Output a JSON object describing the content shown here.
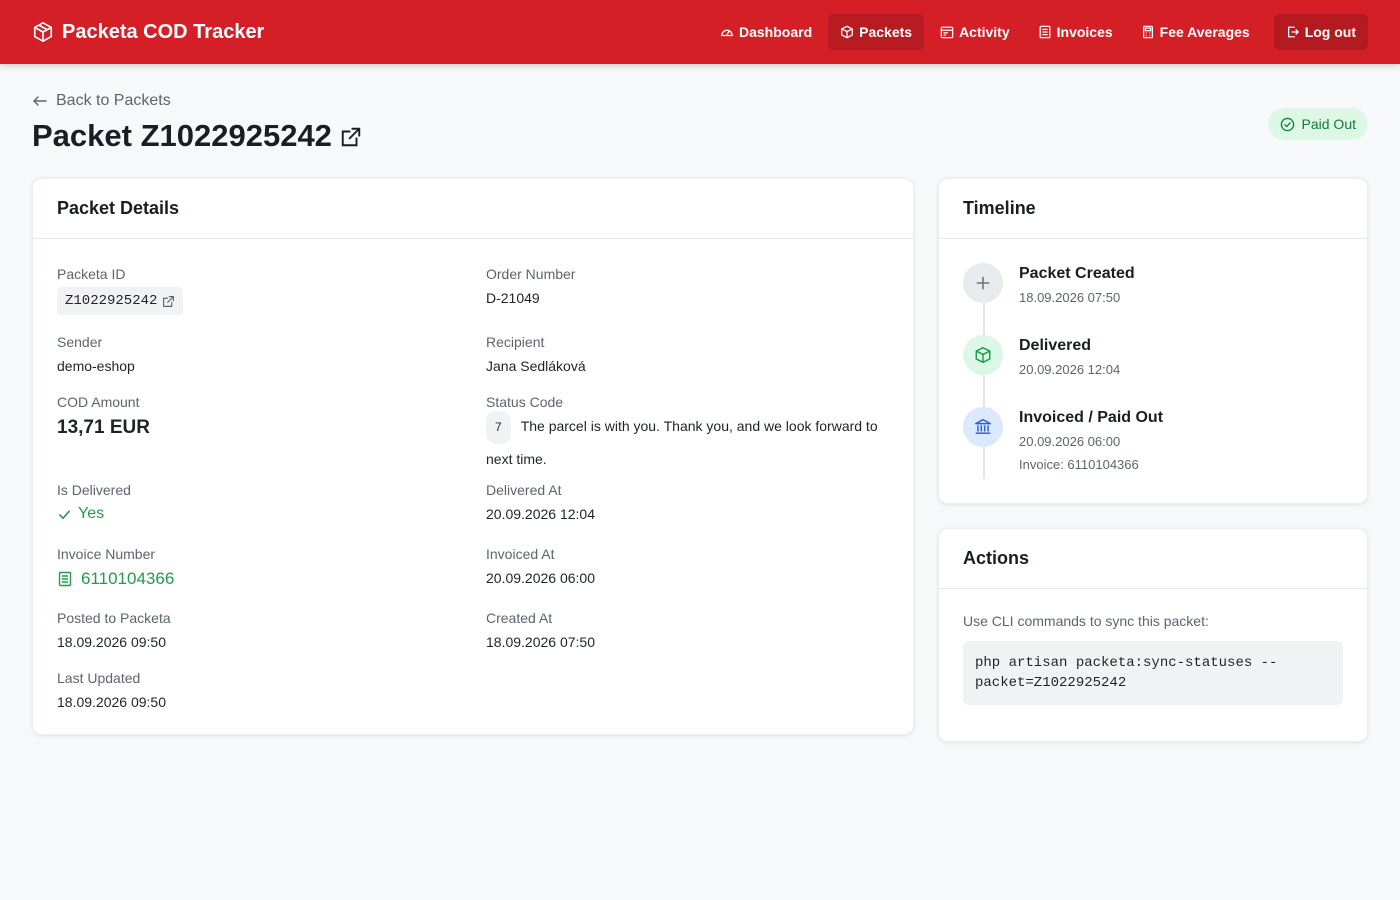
{
  "nav": {
    "brand": "Packeta COD Tracker",
    "links": [
      "Dashboard",
      "Packets",
      "Activity",
      "Invoices",
      "Fee Averages"
    ],
    "logout": "Log out"
  },
  "page": {
    "back": "Back to Packets",
    "title": "Packet Z1022925242",
    "status": "Paid Out"
  },
  "details": {
    "header": "Packet Details",
    "packeta_id_label": "Packeta ID",
    "packeta_id": "Z1022925242",
    "order_number_label": "Order Number",
    "order_number": "D-21049",
    "sender_label": "Sender",
    "sender": "demo-eshop",
    "recipient_label": "Recipient",
    "recipient": "Jana Sedláková",
    "cod_label": "COD Amount",
    "cod": "13,71 EUR",
    "status_code_label": "Status Code",
    "status_code": "7",
    "status_text": "The parcel is with you. Thank you, and we look forward to next time.",
    "is_delivered_label": "Is Delivered",
    "is_delivered": "Yes",
    "delivered_at_label": "Delivered At",
    "delivered_at": "20.09.2026 12:04",
    "invoice_number_label": "Invoice Number",
    "invoice_number": "6110104366",
    "invoiced_at_label": "Invoiced At",
    "invoiced_at": "20.09.2026 06:00",
    "posted_label": "Posted to Packeta",
    "posted": "18.09.2026 09:50",
    "created_at_label": "Created At",
    "created_at": "18.09.2026 07:50",
    "last_updated_label": "Last Updated",
    "last_updated": "18.09.2026 09:50"
  },
  "timeline": {
    "header": "Timeline",
    "items": [
      {
        "title": "Packet Created",
        "date": "18.09.2026 07:50",
        "icon": "plus-icon"
      },
      {
        "title": "Delivered",
        "date": "20.09.2026 12:04",
        "icon": "box-icon"
      },
      {
        "title": "Invoiced / Paid Out",
        "date": "20.09.2026 06:00",
        "extra": "Invoice: 6110104366",
        "icon": "bank-icon"
      }
    ]
  },
  "actions": {
    "header": "Actions",
    "text": "Use CLI commands to sync this packet:",
    "command": "php artisan packeta:sync-statuses --\npacket=Z1022925242"
  },
  "colors": {
    "brand": "#d51f27",
    "success": "#1f9d4c",
    "badge_bg": "#dcf7e5"
  }
}
